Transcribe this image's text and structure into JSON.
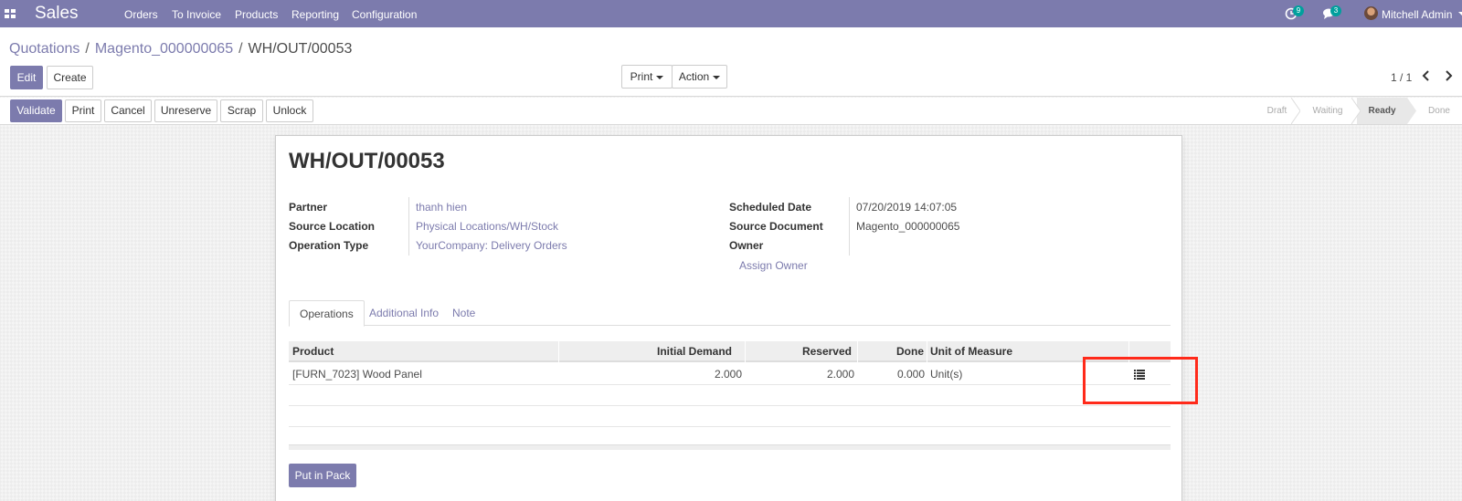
{
  "navbar": {
    "app_name": "Sales",
    "menu": [
      "Orders",
      "To Invoice",
      "Products",
      "Reporting",
      "Configuration"
    ],
    "activity_count": "9",
    "message_count": "3",
    "user_name": "Mitchell Admin",
    "accent_color": "#7c7bad",
    "badge_color": "#00a09d"
  },
  "breadcrumb": {
    "items": [
      "Quotations",
      "Magento_000000065",
      "WH/OUT/00053"
    ],
    "separator": "/"
  },
  "control": {
    "edit_label": "Edit",
    "create_label": "Create",
    "print_label": "Print",
    "action_label": "Action",
    "pager": "1 / 1"
  },
  "statusbar": {
    "buttons": [
      "Validate",
      "Print",
      "Cancel",
      "Unreserve",
      "Scrap",
      "Unlock"
    ],
    "stages": [
      "Draft",
      "Waiting",
      "Ready",
      "Done"
    ],
    "active_stage": "Ready"
  },
  "record": {
    "title": "WH/OUT/00053",
    "partner_label": "Partner",
    "partner_value": "thanh hien",
    "source_location_label": "Source Location",
    "source_location_value": "Physical Locations/WH/Stock",
    "operation_type_label": "Operation Type",
    "operation_type_value": "YourCompany: Delivery Orders",
    "scheduled_date_label": "Scheduled Date",
    "scheduled_date_value": "07/20/2019 14:07:05",
    "source_document_label": "Source Document",
    "source_document_value": "Magento_000000065",
    "owner_label": "Owner",
    "assign_owner_label": "Assign Owner"
  },
  "tabs": [
    "Operations",
    "Additional Info",
    "Note"
  ],
  "operations_table": {
    "columns": [
      "Product",
      "Initial Demand",
      "Reserved",
      "Done",
      "Unit of Measure"
    ],
    "rows": [
      {
        "product": "[FURN_7023] Wood Panel",
        "initial_demand": "2.000",
        "reserved": "2.000",
        "done": "0.000",
        "uom": "Unit(s)",
        "detail_icon": "list-icon"
      }
    ]
  },
  "put_in_pack_label": "Put in Pack",
  "highlight_color": "#ff2a1a"
}
